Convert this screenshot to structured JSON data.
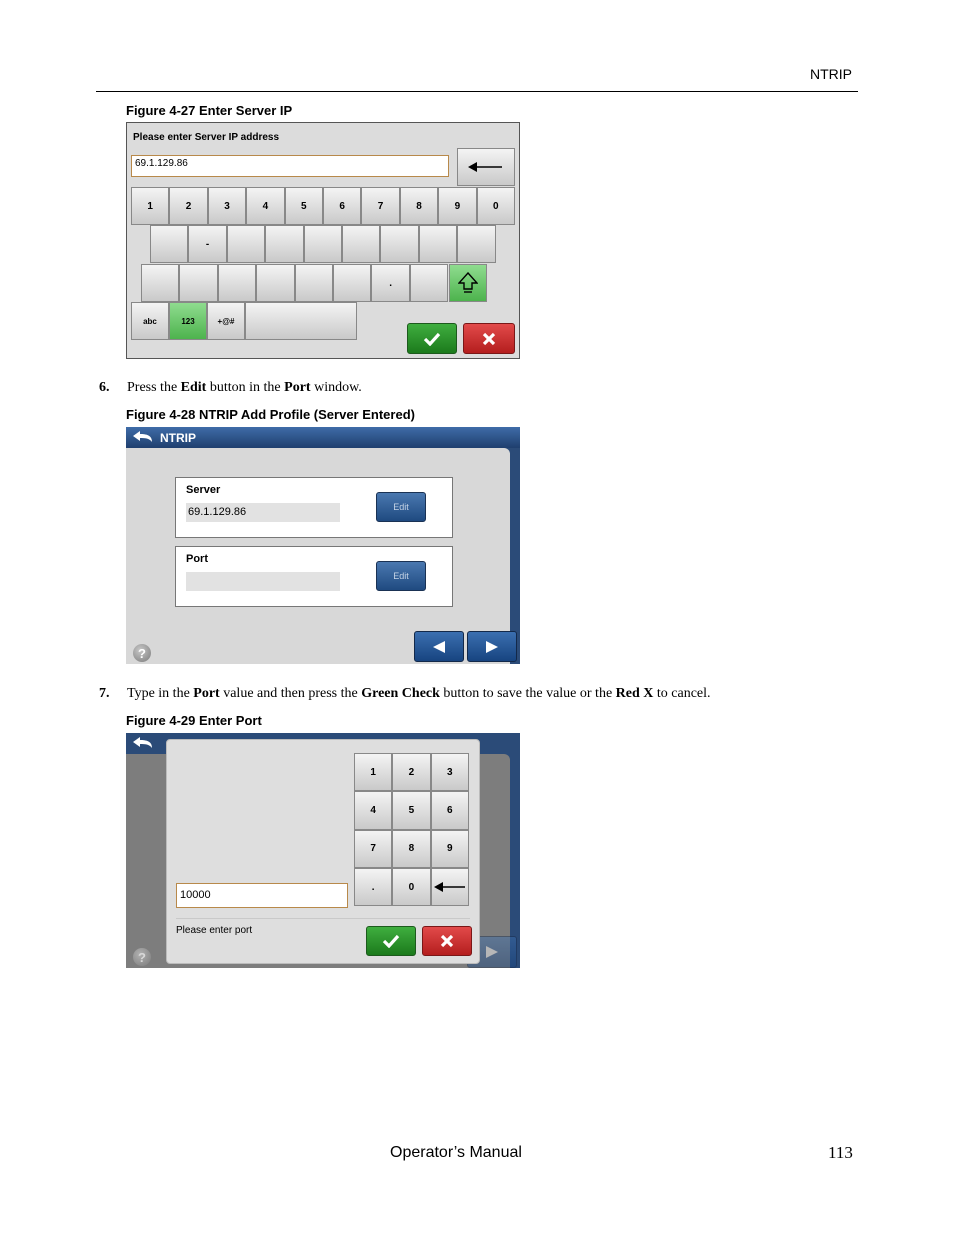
{
  "header": {
    "title": "NTRIP"
  },
  "figures": {
    "fig27": {
      "caption": "Figure 4-27  Enter Server IP",
      "prompt": "Please enter Server IP address",
      "ip_value": "69.1.129.86",
      "row1": [
        "1",
        "2",
        "3",
        "4",
        "5",
        "6",
        "7",
        "8",
        "9",
        "0"
      ],
      "row2": [
        "",
        "-",
        "",
        "",
        "",
        "",
        "",
        "",
        ""
      ],
      "row3": [
        "",
        "",
        "",
        "",
        "",
        "",
        ".",
        " "
      ],
      "mode_keys": [
        "abc",
        "123",
        "+@#"
      ],
      "icons": {
        "backspace": "backspace-arrow-icon",
        "shift": "shift-icon",
        "ok": "checkmark-icon",
        "cancel": "x-icon"
      },
      "colors": {
        "ok": "#2a942a",
        "cancel": "#c92a2a",
        "active_key": "#6fcf6f"
      }
    },
    "fig28": {
      "caption": "Figure 4-28  NTRIP Add Profile (Server Entered)",
      "title": "NTRIP",
      "server_label": "Server",
      "server_value": "69.1.129.86",
      "port_label": "Port",
      "port_value": "",
      "edit_label": "Edit",
      "help_glyph": "?",
      "icons": {
        "back": "back-arrow-icon",
        "prev": "left-arrow-icon",
        "next": "right-arrow-icon",
        "help": "help-icon"
      }
    },
    "fig29": {
      "caption": "Figure 4-29  Enter Port",
      "keypad": [
        "1",
        "2",
        "3",
        "4",
        "5",
        "6",
        "7",
        "8",
        "9",
        ".",
        "0",
        ""
      ],
      "port_value": "10000",
      "prompt": "Please enter port",
      "help_glyph": "?"
    }
  },
  "steps": [
    {
      "num": "6.",
      "parts": [
        "Press the ",
        "Edit",
        " button in the ",
        "Port",
        " window."
      ]
    },
    {
      "num": "7.",
      "parts": [
        "Type in the ",
        "Port",
        " value and then press the ",
        "Green Check",
        " button to save the value or the ",
        "Red X",
        " to cancel."
      ]
    }
  ],
  "footer": {
    "manual": "Operator’s Manual",
    "page": "113"
  }
}
